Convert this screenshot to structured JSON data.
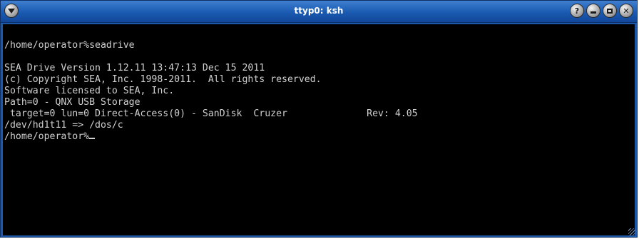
{
  "window": {
    "title": "ttyp0: ksh"
  },
  "terminal": {
    "prompt_line": "/home/operator%seadrive",
    "output_lines": [
      "",
      "SEA Drive Version 1.12.11 13:47:13 Dec 15 2011",
      "(c) Copyright SEA, Inc. 1998-2011.  All rights reserved.",
      "Software licensed to SEA, Inc.",
      "Path=0 - QNX USB Storage",
      " target=0 lun=0 Direct-Access(0) - SanDisk  Cruzer              Rev: 4.05",
      "/dev/hd1t11 => /dos/c"
    ],
    "current_prompt": "/home/operator%"
  },
  "icons": {
    "menu": "chevron-down-icon",
    "help": "help-icon",
    "minimize": "minimize-icon",
    "maximize": "maximize-icon",
    "close": "close-icon"
  },
  "colors": {
    "titlebar": "#1a5ab0",
    "terminal_bg": "#000000",
    "terminal_fg": "#d0d0d0"
  }
}
